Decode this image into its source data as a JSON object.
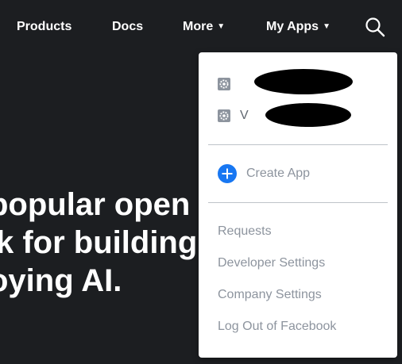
{
  "nav": {
    "products": "Products",
    "docs": "Docs",
    "more": "More",
    "my_apps": "My Apps",
    "caret": "▼",
    "search_icon": "search-icon"
  },
  "hero": {
    "lines": [
      "popular open",
      "k for building",
      "oying AI."
    ]
  },
  "dropdown": {
    "apps": [
      {
        "name": "",
        "icon": "gear-icon",
        "redacted": true
      },
      {
        "name": "V",
        "icon": "gear-icon",
        "redacted": true
      }
    ],
    "create_app": {
      "label": "Create App",
      "icon": "plus-circle-icon",
      "color": "#1877f2"
    },
    "links": [
      "Requests",
      "Developer Settings",
      "Company Settings",
      "Log Out of Facebook"
    ]
  },
  "colors": {
    "background": "#1c1e21",
    "nav_text": "#ffffff",
    "menu_text": "#8d949e",
    "accent": "#1877f2",
    "divider": "#bec3c9"
  }
}
